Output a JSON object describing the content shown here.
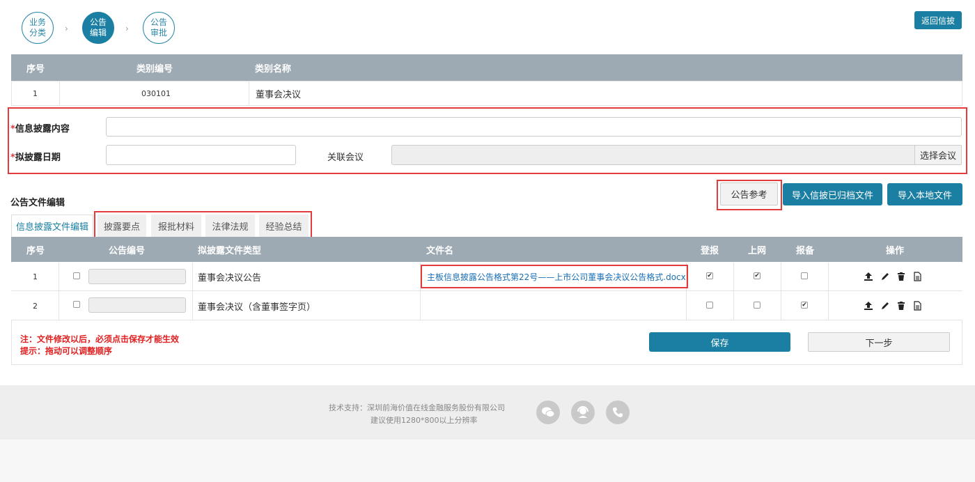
{
  "steps": [
    {
      "line1": "业务",
      "line2": "分类",
      "active": false
    },
    {
      "line1": "公告",
      "line2": "编辑",
      "active": true
    },
    {
      "line1": "公告",
      "line2": "审批",
      "active": false
    }
  ],
  "step_sep": "›",
  "back_button": "返回信披",
  "category_table": {
    "headers": [
      "序号",
      "类别编号",
      "类别名称"
    ],
    "row": {
      "index": "1",
      "code": "030101",
      "name": "董事会决议"
    }
  },
  "form": {
    "disclosure_content_label": "信息披露内容",
    "disclosure_content_value": "",
    "disclosure_date_label": "拟披露日期",
    "disclosure_date_value": "",
    "related_meeting_label": "关联会议",
    "related_meeting_value": "",
    "select_meeting_button": "选择会议",
    "required_mark": "*"
  },
  "section": {
    "title": "公告文件编辑",
    "reference_button": "公告参考",
    "import_archived_button": "导入信披已归档文件",
    "import_local_button": "导入本地文件"
  },
  "tabs": [
    "信息披露文件编辑",
    "披露要点",
    "报批材料",
    "法律法规",
    "经验总结"
  ],
  "file_table": {
    "headers": [
      "序号",
      "公告编号",
      "拟披露文件类型",
      "文件名",
      "登报",
      "上网",
      "报备",
      "操作"
    ],
    "rows": [
      {
        "index": "1",
        "selected": false,
        "announcement_no": "",
        "type": "董事会决议公告",
        "file_name": "主板信息披露公告格式第22号——上市公司董事会决议公告格式.docx",
        "newspaper": true,
        "online": true,
        "filing": false
      },
      {
        "index": "2",
        "selected": false,
        "announcement_no": "",
        "type": "董事会决议（含董事签字页）",
        "file_name": "",
        "newspaper": false,
        "online": false,
        "filing": true
      }
    ]
  },
  "notes": {
    "note1": "注：文件修改以后，必须点击保存才能生效",
    "note2": "提示：拖动可以调整顺序"
  },
  "actions": {
    "save": "保存",
    "next": "下一步"
  },
  "footer": {
    "support": "技术支持：深圳前海价值在线金融服务股份有限公司",
    "resolution": "建议使用1280*800以上分辨率",
    "icons": [
      "wechat-icon",
      "customer-service-icon",
      "phone-icon"
    ]
  },
  "colors": {
    "accent": "#1a7fa3",
    "header": "#9eaab3",
    "highlight": "#e33b3b"
  }
}
